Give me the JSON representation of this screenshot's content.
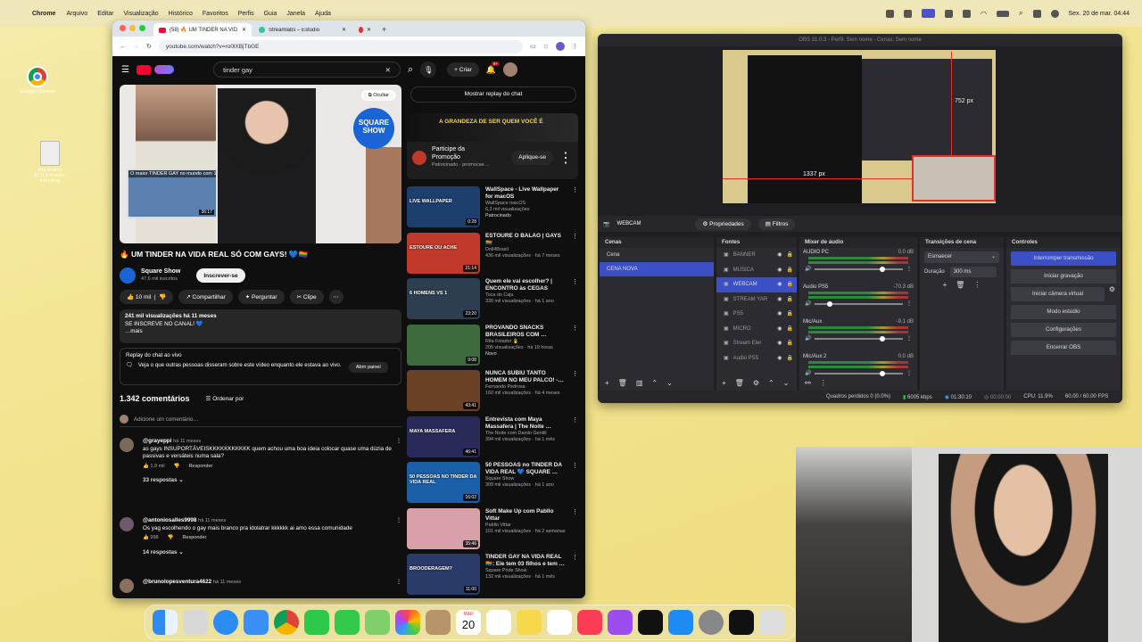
{
  "menubar": {
    "app": "Chrome",
    "items": [
      "Arquivo",
      "Editar",
      "Visualização",
      "Histórico",
      "Favoritos",
      "Perfis",
      "Guia",
      "Janela",
      "Ajuda"
    ],
    "clock": "Sex. 20 de mar. 04:44"
  },
  "desktop": {
    "icons": [
      {
        "label": "Google Chrome"
      },
      {
        "label": "obs-studio-31.0.3-macos-intel.dmg"
      }
    ]
  },
  "chrome": {
    "tabs": [
      {
        "label": "(58) 🔥 UM TINDER NA VID…"
      },
      {
        "label": "Streamlabs – Estúdio"
      }
    ],
    "url": "youtube.com/watch?v=ro0lXBjTbGE"
  },
  "youtube": {
    "search_value": "tinder gay",
    "create_label": "Criar",
    "notif_count": "9+",
    "hide_label": "Ocultar",
    "inset_title": "O maior TINDER GAY no mundo com 10 …",
    "inset_time": "36:17",
    "video_title": "🔥 UM TINDER NA VIDA REAL SÓ COM GAYS! 💙🏳️‍🌈",
    "channel": "Square Show",
    "subs": "47,6 mil inscritos",
    "subscribe": "Inscrever-se",
    "likes": "10 mil",
    "share": "Compartilhar",
    "ask": "Perguntar",
    "clip": "Clipe",
    "views_line": "241 mil visualizações  há 11 meses",
    "desc": "SE INSCREVE NO CANAL! 💙",
    "more": "…mais",
    "chat_replay_title": "Replay do chat ao vivo",
    "chat_replay_text": "Veja o que outras pessoas disseram sobre este vídeo enquanto ele estava ao vivo.",
    "open_panel": "Abrir painel",
    "show_chat": "Mostrar replay do chat",
    "comments_count": "1.342 comentários",
    "sort": "Ordenar por",
    "add_comment": "Adicione um comentário…",
    "ad": {
      "title": "Participe da Promoção",
      "sponsored": "Patrocinado · promocae…",
      "cta": "Aplique-se",
      "banner": "A GRANDEZA DE SER QUEM VOCÊ É"
    },
    "comments": [
      {
        "user": "@grayeppi",
        "time": "há 11 meses",
        "text": "as gays INSUPORTÁVEISKKKKKKKKKKK quem achou uma boa ideia colocar quase uma dúzia de passivas e versáteis numa sala?",
        "likes": "1,9 mil",
        "reply": "Responder",
        "replies": "33 respostas"
      },
      {
        "user": "@antoniosalles9998",
        "time": "há 11 meses",
        "text": "Os yag escolhendo o gay mais branco pra idolatrar kkkkkk ai amo essa comunidade",
        "likes": "998",
        "reply": "Responder",
        "replies": "14 respostas"
      },
      {
        "user": "@brunolopesventura4622",
        "time": "há 11 meses"
      }
    ],
    "related": [
      {
        "title": "WallSpace - Live Wallpaper for macOS",
        "channel": "WallSpace macOS",
        "meta": "6,3 mil visualizações",
        "extra": "Patrocinado",
        "dur": "0:28",
        "thumb": "LIVE WALLPAPER"
      },
      {
        "title": "ESTOURE O BALÃO | GAYS 🏳️‍🌈",
        "channel": "Doll4Brasil",
        "meta": "436 mil visualizações · há 7 meses",
        "dur": "21:14",
        "thumb": "ESTOURE OU ACHE"
      },
      {
        "title": "Quem ele vai escolher? | ENCONTRO às CEGAS",
        "channel": "Toca do Caju",
        "meta": "330 mil visualizações · há 1 ano",
        "dur": "23:20",
        "thumb": "6 HOMENS VS 1"
      },
      {
        "title": "PROVANDO SNACKS BRASILEIROS COM …",
        "channel": "Rita Folador 🍍",
        "meta": "205 visualizações · há 19 horas",
        "extra": "Novo",
        "dur": "9:08",
        "thumb": ""
      },
      {
        "title": "NUNCA SUBIU TANTO HOMEM NO MEU PALCO! -…",
        "channel": "Fernando Pedrosa",
        "meta": "160 mil visualizações · há 4 meses",
        "dur": "43:41",
        "thumb": ""
      },
      {
        "title": "Entrevista com Maya Massafera | The Noite …",
        "channel": "The Noite com Danilo Gentili",
        "meta": "394 mil visualizações · há 1 mês",
        "dur": "46:41",
        "thumb": "MAYA MASSAFERA"
      },
      {
        "title": "50 PESSOAS no TINDER DA VIDA REAL 💙 SQUARE …",
        "channel": "Square Show",
        "meta": "309 mil visualizações · há 1 ano",
        "dur": "16:02",
        "thumb": "50 PESSOAS NO TINDER DA VIDA REAL"
      },
      {
        "title": "Soft Make Up com Pabllo Vittar",
        "channel": "Pabllo Vittar",
        "meta": "101 mil visualizações · há 2 semanas",
        "dur": "35:46",
        "thumb": ""
      },
      {
        "title": "TINDER GAY NA VIDA REAL 🏳️‍🌈: Ele tem 03 filhos e tem …",
        "channel": "Square Pride Show",
        "meta": "132 mil visualizações · há 1 mês",
        "dur": "11:00",
        "thumb": "BROODERAGEM?"
      }
    ]
  },
  "obs": {
    "title": "OBS 31.0.3 - Perfil: Sem nome - Cenas: Sem nome",
    "dim_a": "752 px",
    "dim_b": "1337 px",
    "source_label": "WEBCAM",
    "props": "Propriedades",
    "filters": "Filtros",
    "scenes_title": "Cenas",
    "scenes": [
      "Cena",
      "CENA NOVA"
    ],
    "sources_title": "Fontes",
    "sources": [
      "BANNER",
      "MUSICA",
      "WEBCAM",
      "STREAM YAR",
      "PS5",
      "MICRO",
      "Stream Eler",
      "Audio PS5"
    ],
    "mixer_title": "Mixer de áudio",
    "mixer": [
      {
        "name": "AUDIO PC",
        "db": "0.0 dB"
      },
      {
        "name": "Audio PS5",
        "db": "-70.3 dB"
      },
      {
        "name": "Mic/Aux",
        "db": "-9.1 dB"
      },
      {
        "name": "Mic/Aux 2",
        "db": "0.0 dB"
      }
    ],
    "transitions_title": "Transições de cena",
    "transition": "Esmaecer",
    "duration_label": "Duração",
    "duration": "300 ms",
    "controls_title": "Controles",
    "controls": [
      "Interromper transmissão",
      "Iniciar gravação",
      "Iniciar câmera virtual",
      "Modo estúdio",
      "Configurações",
      "Encerrar OBS"
    ],
    "status": {
      "dropped": "Quadros perdidos 0 (0.0%)",
      "kbps": "6005 kbps",
      "live": "01:30:10",
      "rec": "00:00:00",
      "cpu": "CPU: 11.9%",
      "fps": "60.00 / 60.00 FPS"
    }
  },
  "dock": {
    "date_month": "MAR",
    "date_day": "20"
  },
  "colors": {
    "yt_red": "#ff0033",
    "obs_blue": "#3b4fc6",
    "desktop": "#f2e48f"
  }
}
